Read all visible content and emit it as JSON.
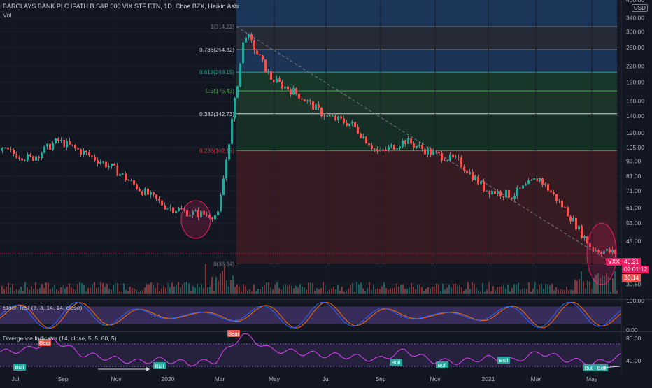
{
  "header": {
    "title": "BARCLAYS BANK PLC IPATH B S&P 500 VIX STF ETN, 1D, Cboe BZX, Heikin Ashi",
    "vol_label": "Vol"
  },
  "axis": {
    "currency": "USD",
    "price_ticks": [
      "400.00",
      "340.00",
      "300.00",
      "260.00",
      "220.00",
      "190.00",
      "160.00",
      "140.00",
      "120.00",
      "105.00",
      "93.00",
      "81.00",
      "71.00",
      "61.00",
      "53.00",
      "45.00",
      "30.50"
    ],
    "time_ticks": [
      "Jul",
      "Sep",
      "Nov",
      "2020",
      "Mar",
      "May",
      "Jul",
      "Sep",
      "Nov",
      "2021",
      "Mar",
      "May"
    ],
    "stoch_ticks": [
      "100.00",
      "0.00"
    ],
    "div_ticks": [
      "80.00",
      "40.00"
    ]
  },
  "price_tags": {
    "symbol": "VXX",
    "last": "40.21",
    "countdown": "02:01:12",
    "low": "39.14"
  },
  "fib_levels": [
    {
      "label": "1(314.22)",
      "color": "#787b86"
    },
    {
      "label": "0.786(254.82)",
      "color": "#d1d4dc"
    },
    {
      "label": "0.618(208.15)",
      "color": "#26a69a"
    },
    {
      "label": "0.5(175.43)",
      "color": "#4caf50"
    },
    {
      "label": "0.382(142.73)",
      "color": "#d1d4dc"
    },
    {
      "label": "0.236(102.15)",
      "color": "#f23645"
    },
    {
      "label": "0(36.64)",
      "color": "#787b86"
    }
  ],
  "indicators": {
    "stoch_label": "Stoch RSI (3, 3, 14, 14, close)",
    "div_label": "Divergence Indicator (14, close, 5, 5, 60, 5)",
    "tags": [
      {
        "text": "Bull",
        "kind": "bull"
      },
      {
        "text": "Bull",
        "kind": "bull"
      },
      {
        "text": "Bear",
        "kind": "bear"
      },
      {
        "text": "Bear",
        "kind": "bear"
      },
      {
        "text": "Bull",
        "kind": "bull"
      },
      {
        "text": "Bull",
        "kind": "bull"
      },
      {
        "text": "Bull",
        "kind": "bull"
      },
      {
        "text": "Bull",
        "kind": "bull"
      },
      {
        "text": "Bull",
        "kind": "bull"
      }
    ]
  },
  "colors": {
    "background": "#131722",
    "up": "#26a69a",
    "down": "#ef5350",
    "stoch_k": "#2962ff",
    "stoch_d": "#ff6d00",
    "band": "#7e57c2",
    "div_line": "#e040fb",
    "highlight": "#e91e63"
  },
  "chart_data": {
    "type": "candlestick",
    "chart_style": "Heikin Ashi",
    "interval": "1D",
    "x": [
      "2019-06",
      "2019-07",
      "2019-08",
      "2019-09",
      "2019-10",
      "2019-11",
      "2019-12",
      "2020-01",
      "2020-02",
      "2020-03",
      "2020-04",
      "2020-05",
      "2020-06",
      "2020-07",
      "2020-08",
      "2020-09",
      "2020-10",
      "2020-11",
      "2020-12",
      "2021-01",
      "2021-02",
      "2021-03",
      "2021-04",
      "2021-05"
    ],
    "close": [
      102,
      95,
      112,
      100,
      88,
      73,
      62,
      58,
      57,
      300,
      195,
      170,
      140,
      130,
      100,
      112,
      100,
      93,
      72,
      68,
      80,
      60,
      42,
      40.21
    ],
    "y_scale": "log",
    "ylim": [
      28,
      400
    ],
    "fibonacci": [
      {
        "ratio": 1,
        "price": 314.22
      },
      {
        "ratio": 0.786,
        "price": 254.82
      },
      {
        "ratio": 0.618,
        "price": 208.15
      },
      {
        "ratio": 0.5,
        "price": 175.43
      },
      {
        "ratio": 0.382,
        "price": 142.73
      },
      {
        "ratio": 0.236,
        "price": 102.15
      },
      {
        "ratio": 0,
        "price": 36.64
      }
    ],
    "last_price": 40.21,
    "stoch_rsi": {
      "k": [
        80,
        20,
        90,
        15,
        85,
        25,
        95,
        10,
        70,
        30,
        88,
        20,
        92,
        15,
        75,
        35,
        90,
        22,
        80,
        40,
        95,
        30,
        60,
        92
      ],
      "bands": [
        20,
        80
      ]
    },
    "divergence": {
      "rsi": [
        55,
        60,
        78,
        52,
        45,
        38,
        42,
        35,
        40,
        88,
        60,
        55,
        50,
        48,
        42,
        58,
        40,
        38,
        45,
        40,
        55,
        42,
        35,
        48
      ],
      "ylim": [
        20,
        90
      ]
    }
  }
}
